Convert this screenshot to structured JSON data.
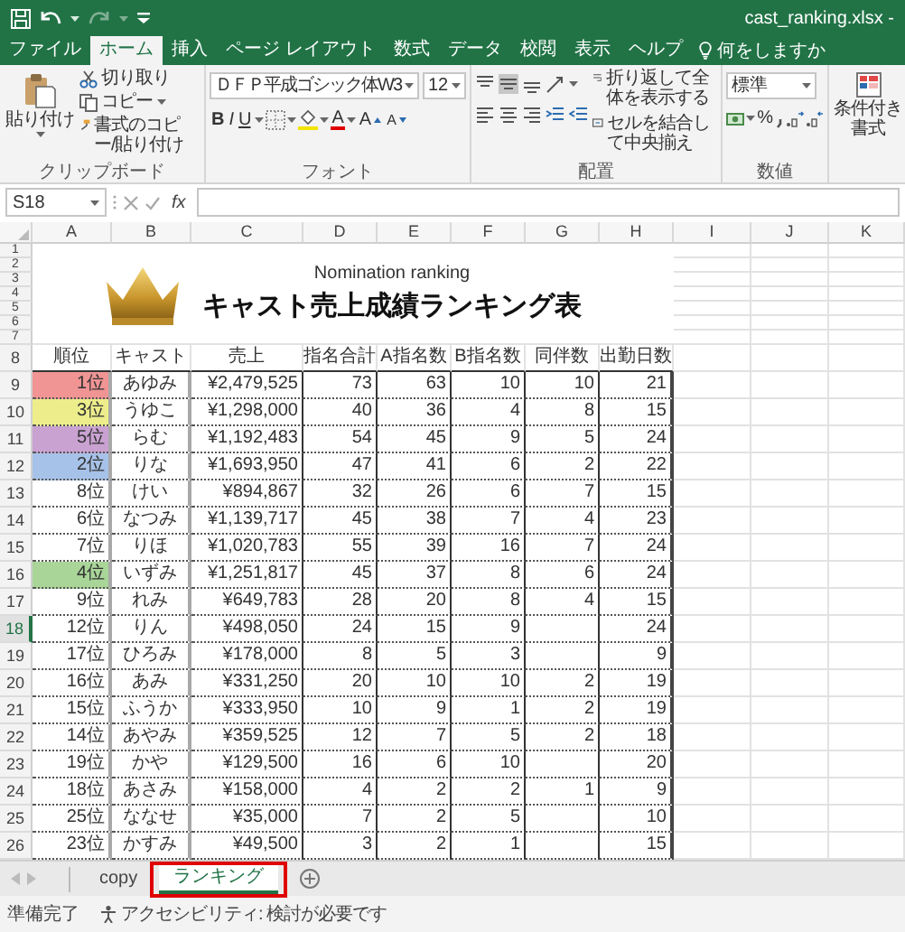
{
  "window": {
    "title": "cast_ranking.xlsx -"
  },
  "ribbon_tabs": [
    {
      "label": "ファイル",
      "selected": false
    },
    {
      "label": "ホーム",
      "selected": true
    },
    {
      "label": "挿入",
      "selected": false
    },
    {
      "label": "ページ レイアウト",
      "selected": false
    },
    {
      "label": "数式",
      "selected": false
    },
    {
      "label": "データ",
      "selected": false
    },
    {
      "label": "校閲",
      "selected": false
    },
    {
      "label": "表示",
      "selected": false
    },
    {
      "label": "ヘルプ",
      "selected": false
    }
  ],
  "tell_me": "何をしますか",
  "clipboard": {
    "paste": "貼り付け",
    "cut": "切り取り",
    "copy": "コピー",
    "format_painter": "書式のコピー/貼り付け",
    "label": "クリップボード"
  },
  "font": {
    "name": "ＤＦＰ平成ゴシック体W3",
    "size": "12",
    "grow": "A",
    "shrink": "A",
    "bold": "B",
    "italic": "I",
    "underline": "U",
    "color_letter": "A",
    "label": "フォント"
  },
  "alignment": {
    "vertical_align": [
      {
        "selected": false
      },
      {
        "selected": true
      },
      {
        "selected": false
      }
    ],
    "wrap_text": "折り返して全体を表示する",
    "merge_center": "セルを結合して中央揃え",
    "label": "配置"
  },
  "number": {
    "format": "標準",
    "percent": "%",
    "label": "数値"
  },
  "styles": {
    "conditional_formatting": "条件付き書式"
  },
  "formula_bar": {
    "name_box": "S18",
    "function_button": "fx"
  },
  "sheet": {
    "columns": [
      "A",
      "B",
      "C",
      "D",
      "E",
      "F",
      "G",
      "H",
      "I",
      "J",
      "K"
    ],
    "top_rows": [
      "1",
      "2",
      "3",
      "4",
      "5",
      "6",
      "7"
    ],
    "title": {
      "subtitle": "Nomination ranking",
      "heading": "キャスト売上成績ランキング表"
    },
    "header": {
      "row": "8",
      "cells": [
        "順位",
        "キャスト",
        "売上",
        "指名合計",
        "A指名数",
        "B指名数",
        "同伴数",
        "出勤日数"
      ]
    },
    "rows": [
      {
        "row": "9",
        "rank": "1位",
        "color": "#f09494",
        "cast": "あゆみ",
        "values": {
          "sales": "¥2,479,525",
          "total": "73",
          "a_count": "63",
          "b_count": "10",
          "companion": "10",
          "days": "21"
        },
        "selected": false
      },
      {
        "row": "10",
        "rank": "3位",
        "color": "#eded8c",
        "cast": "うゆこ",
        "values": {
          "sales": "¥1,298,000",
          "total": "40",
          "a_count": "36",
          "b_count": "4",
          "companion": "8",
          "days": "15"
        },
        "selected": false
      },
      {
        "row": "11",
        "rank": "5位",
        "color": "#c9a2d2",
        "cast": "らむ",
        "values": {
          "sales": "¥1,192,483",
          "total": "54",
          "a_count": "45",
          "b_count": "9",
          "companion": "5",
          "days": "24"
        },
        "selected": false
      },
      {
        "row": "12",
        "rank": "2位",
        "color": "#a7c2e8",
        "cast": "りな",
        "values": {
          "sales": "¥1,693,950",
          "total": "47",
          "a_count": "41",
          "b_count": "6",
          "companion": "2",
          "days": "22"
        },
        "selected": false
      },
      {
        "row": "13",
        "rank": "8位",
        "cast": "けい",
        "values": {
          "sales": "¥894,867",
          "total": "32",
          "a_count": "26",
          "b_count": "6",
          "companion": "7",
          "days": "15"
        },
        "selected": false
      },
      {
        "row": "14",
        "rank": "6位",
        "cast": "なつみ",
        "values": {
          "sales": "¥1,139,717",
          "total": "45",
          "a_count": "38",
          "b_count": "7",
          "companion": "4",
          "days": "23"
        },
        "selected": false
      },
      {
        "row": "15",
        "rank": "7位",
        "cast": "りほ",
        "values": {
          "sales": "¥1,020,783",
          "total": "55",
          "a_count": "39",
          "b_count": "16",
          "companion": "7",
          "days": "24"
        },
        "selected": false
      },
      {
        "row": "16",
        "rank": "4位",
        "color": "#a9d599",
        "cast": "いずみ",
        "values": {
          "sales": "¥1,251,817",
          "total": "45",
          "a_count": "37",
          "b_count": "8",
          "companion": "6",
          "days": "24"
        },
        "selected": false
      },
      {
        "row": "17",
        "rank": "9位",
        "cast": "れみ",
        "values": {
          "sales": "¥649,783",
          "total": "28",
          "a_count": "20",
          "b_count": "8",
          "companion": "4",
          "days": "15"
        },
        "selected": false
      },
      {
        "row": "18",
        "rank": "12位",
        "cast": "りん",
        "values": {
          "sales": "¥498,050",
          "total": "24",
          "a_count": "15",
          "b_count": "9",
          "days": "24"
        },
        "selected": true
      },
      {
        "row": "19",
        "rank": "17位",
        "cast": "ひろみ",
        "values": {
          "sales": "¥178,000",
          "total": "8",
          "a_count": "5",
          "b_count": "3",
          "days": "9"
        },
        "selected": false
      },
      {
        "row": "20",
        "rank": "16位",
        "cast": "あみ",
        "values": {
          "sales": "¥331,250",
          "total": "20",
          "a_count": "10",
          "b_count": "10",
          "companion": "2",
          "days": "19"
        },
        "selected": false
      },
      {
        "row": "21",
        "rank": "15位",
        "cast": "ふうか",
        "values": {
          "sales": "¥333,950",
          "total": "10",
          "a_count": "9",
          "b_count": "1",
          "companion": "2",
          "days": "19"
        },
        "selected": false
      },
      {
        "row": "22",
        "rank": "14位",
        "cast": "あやみ",
        "values": {
          "sales": "¥359,525",
          "total": "12",
          "a_count": "7",
          "b_count": "5",
          "companion": "2",
          "days": "18"
        },
        "selected": false
      },
      {
        "row": "23",
        "rank": "19位",
        "cast": "かや",
        "values": {
          "sales": "¥129,500",
          "total": "16",
          "a_count": "6",
          "b_count": "10",
          "days": "20"
        },
        "selected": false
      },
      {
        "row": "24",
        "rank": "18位",
        "cast": "あさみ",
        "values": {
          "sales": "¥158,000",
          "total": "4",
          "a_count": "2",
          "b_count": "2",
          "companion": "1",
          "days": "9"
        },
        "selected": false
      },
      {
        "row": "25",
        "rank": "25位",
        "cast": "ななせ",
        "values": {
          "sales": "¥35,000",
          "total": "7",
          "a_count": "2",
          "b_count": "5",
          "days": "10"
        },
        "selected": false
      },
      {
        "row": "26",
        "rank": "23位",
        "cast": "かすみ",
        "values": {
          "sales": "¥49,500",
          "total": "3",
          "a_count": "2",
          "b_count": "1",
          "days": "15"
        },
        "selected": false
      }
    ]
  },
  "sheet_tabs": [
    {
      "label": "copy",
      "selected": false
    },
    {
      "label": "ランキング",
      "selected": true
    }
  ],
  "status_bar": {
    "ready": "準備完了",
    "accessibility": "アクセシビリティ: 検討が必要です"
  }
}
